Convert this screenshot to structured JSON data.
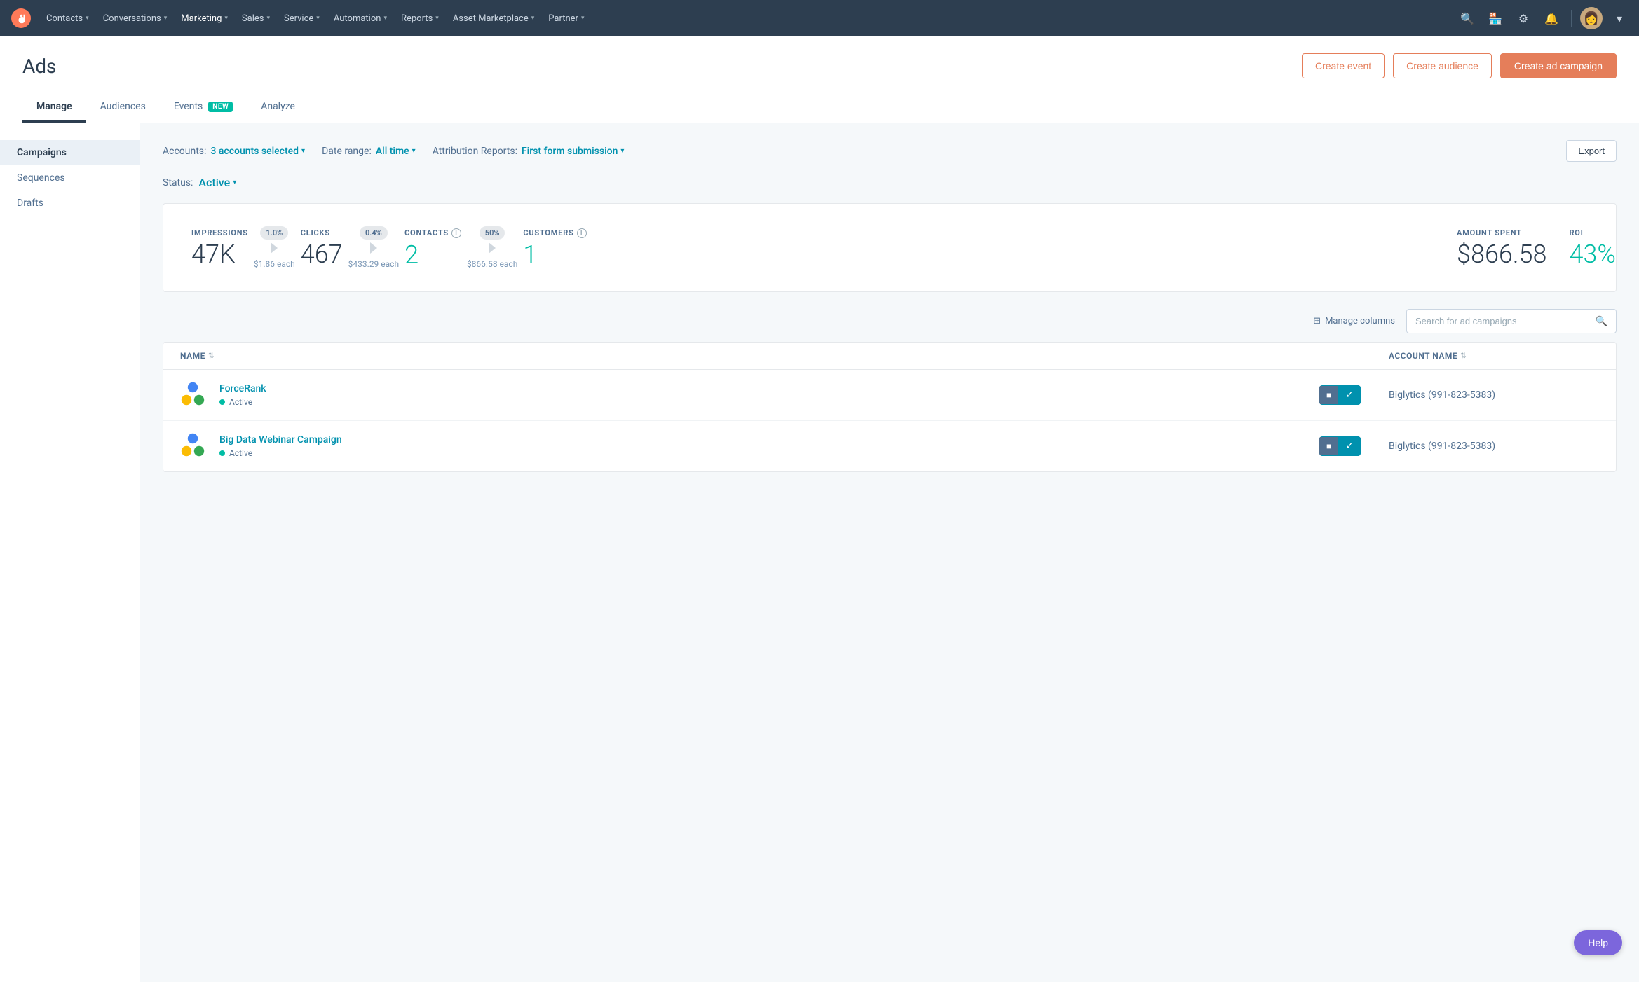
{
  "nav": {
    "items": [
      {
        "label": "Contacts",
        "id": "contacts"
      },
      {
        "label": "Conversations",
        "id": "conversations"
      },
      {
        "label": "Marketing",
        "id": "marketing",
        "active": true
      },
      {
        "label": "Sales",
        "id": "sales"
      },
      {
        "label": "Service",
        "id": "service"
      },
      {
        "label": "Automation",
        "id": "automation"
      },
      {
        "label": "Reports",
        "id": "reports"
      },
      {
        "label": "Asset Marketplace",
        "id": "asset-marketplace"
      },
      {
        "label": "Partner",
        "id": "partner"
      }
    ]
  },
  "page": {
    "title": "Ads"
  },
  "header_buttons": {
    "create_event": "Create event",
    "create_audience": "Create audience",
    "create_campaign": "Create ad campaign"
  },
  "tabs": [
    {
      "label": "Manage",
      "active": true
    },
    {
      "label": "Audiences",
      "active": false
    },
    {
      "label": "Events",
      "active": false,
      "badge": "NEW"
    },
    {
      "label": "Analyze",
      "active": false
    }
  ],
  "sidebar": {
    "items": [
      {
        "label": "Campaigns",
        "active": true
      },
      {
        "label": "Sequences",
        "active": false
      },
      {
        "label": "Drafts",
        "active": false
      }
    ]
  },
  "filters": {
    "accounts_label": "Accounts:",
    "accounts_value": "3 accounts selected",
    "date_range_label": "Date range:",
    "date_range_value": "All time",
    "attribution_label": "Attribution Reports:",
    "attribution_value": "First form submission",
    "status_label": "Status:",
    "status_value": "Active",
    "export_label": "Export"
  },
  "stats": {
    "impressions": {
      "label": "IMPRESSIONS",
      "value": "47K",
      "sub": ""
    },
    "connector1": {
      "pct": "1.0%",
      "cost": "$1.86 each"
    },
    "clicks": {
      "label": "CLICKS",
      "value": "467",
      "sub": ""
    },
    "connector2": {
      "pct": "0.4%",
      "cost": "$433.29 each"
    },
    "contacts": {
      "label": "CONTACTS",
      "value": "2",
      "sub": ""
    },
    "connector3": {
      "pct": "50%",
      "cost": "$866.58 each"
    },
    "customers": {
      "label": "CUSTOMERS",
      "value": "1",
      "sub": ""
    },
    "amount_spent": {
      "label": "AMOUNT SPENT",
      "value": "$866.58"
    },
    "roi": {
      "label": "ROI",
      "value": "43%"
    }
  },
  "table": {
    "manage_columns": "Manage columns",
    "search_placeholder": "Search for ad campaigns",
    "columns": {
      "name": "NAME",
      "account_name": "ACCOUNT NAME"
    },
    "rows": [
      {
        "name": "ForceRank",
        "status": "Active",
        "account": "Biglytics (991-823-5383)"
      },
      {
        "name": "Big Data Webinar Campaign",
        "status": "Active",
        "account": "Biglytics (991-823-5383)"
      }
    ]
  },
  "help": {
    "label": "Help"
  }
}
